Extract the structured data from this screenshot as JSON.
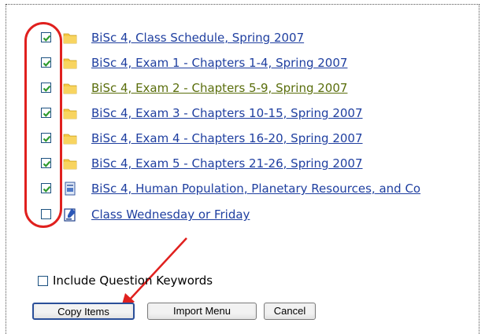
{
  "colors": {
    "link": "#1f3fa0",
    "link_visited": "#5a6e0c",
    "annotation": "#e0201e",
    "folder": "#f5c842"
  },
  "items": [
    {
      "label": "BiSc 4, Class Schedule, Spring 2007",
      "checked": true,
      "icon": "folder-icon"
    },
    {
      "label": "BiSc 4, Exam 1 - Chapters 1-4, Spring 2007",
      "checked": true,
      "icon": "folder-icon"
    },
    {
      "label": "BiSc 4, Exam 2 - Chapters 5-9, Spring 2007",
      "checked": true,
      "icon": "folder-icon",
      "visited": true
    },
    {
      "label": "BiSc 4, Exam 3 - Chapters 10-15, Spring 2007",
      "checked": true,
      "icon": "folder-icon"
    },
    {
      "label": "BiSc 4, Exam 4 - Chapters 16-20, Spring 2007",
      "checked": true,
      "icon": "folder-icon"
    },
    {
      "label": "BiSc 4, Exam 5 - Chapters 21-26, Spring 2007",
      "checked": true,
      "icon": "folder-icon"
    },
    {
      "label": "BiSc 4, Human Population, Planetary Resources, and Co",
      "checked": true,
      "icon": "document-icon"
    },
    {
      "label": "Class Wednesday or Friday",
      "checked": false,
      "icon": "assignment-icon"
    }
  ],
  "options": {
    "include_keywords_label": "Include Question Keywords",
    "include_keywords_checked": false
  },
  "buttons": {
    "copy": "Copy Items",
    "import": "Import Menu",
    "cancel": "Cancel"
  }
}
